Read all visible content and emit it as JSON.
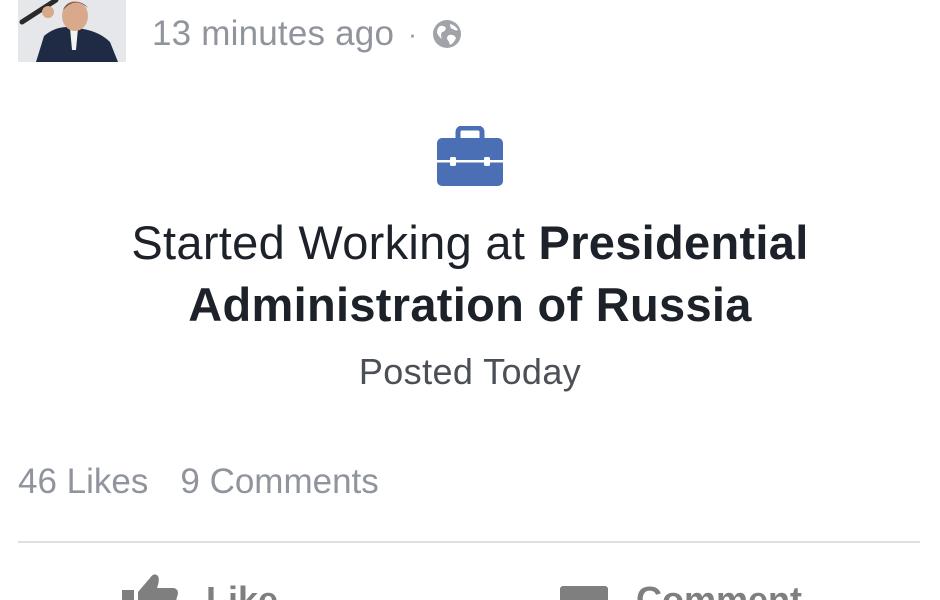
{
  "post": {
    "timestamp": "13 minutes ago",
    "separator": "·",
    "audience_icon": "globe-icon"
  },
  "life_event": {
    "icon": "briefcase-icon",
    "title_prefix": "Started Working at",
    "organization": "Presidential Administration of Russia",
    "date": "Posted Today"
  },
  "engagement": {
    "likes": "46 Likes",
    "comments": "9 Comments"
  },
  "actions": {
    "like_label": "Like",
    "comment_label": "Comment"
  },
  "colors": {
    "accent": "#4a6fb5",
    "muted_text": "#90949c",
    "primary_text": "#1d2129"
  }
}
